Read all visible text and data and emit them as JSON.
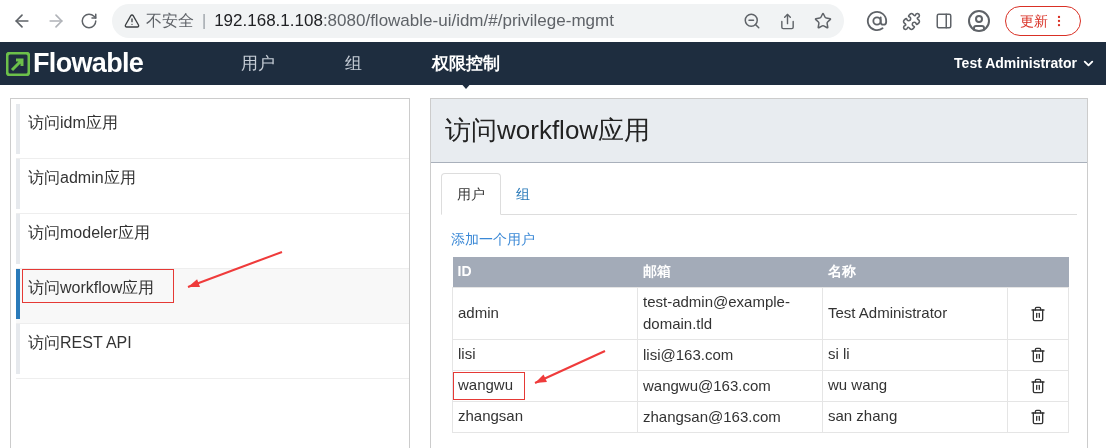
{
  "browser": {
    "security": "不安全",
    "separator": "|",
    "host": "192.168.1.108",
    "path": ":8080/flowable-ui/idm/#/privilege-mgmt",
    "update_button": "更新"
  },
  "navbar": {
    "logo": "Flowable",
    "items": [
      {
        "label": "用户",
        "selected": false
      },
      {
        "label": "组",
        "selected": false
      },
      {
        "label": "权限控制",
        "selected": true
      }
    ],
    "user": "Test Administrator"
  },
  "sidebar": {
    "items": [
      {
        "label": "访问idm应用",
        "selected": false,
        "annotated": false
      },
      {
        "label": "访问admin应用",
        "selected": false,
        "annotated": false
      },
      {
        "label": "访问modeler应用",
        "selected": false,
        "annotated": false
      },
      {
        "label": "访问workflow应用",
        "selected": true,
        "annotated": true
      },
      {
        "label": "访问REST API",
        "selected": false,
        "annotated": false
      }
    ]
  },
  "panel": {
    "title": "访问workflow应用",
    "tabs": [
      {
        "label": "用户",
        "selected": true
      },
      {
        "label": "组",
        "selected": false
      }
    ],
    "add_link": "添加一个用户",
    "table": {
      "columns": [
        "ID",
        "邮箱",
        "名称"
      ],
      "rows": [
        {
          "id": "admin",
          "email": "test-admin@example-domain.tld",
          "name": "Test Administrator",
          "annotated": false
        },
        {
          "id": "lisi",
          "email": "lisi@163.com",
          "name": "si li",
          "annotated": false
        },
        {
          "id": "wangwu",
          "email": "wangwu@163.com",
          "name": "wu wang",
          "annotated": true
        },
        {
          "id": "zhangsan",
          "email": "zhangsan@163.com",
          "name": "san zhang",
          "annotated": false
        }
      ]
    }
  }
}
